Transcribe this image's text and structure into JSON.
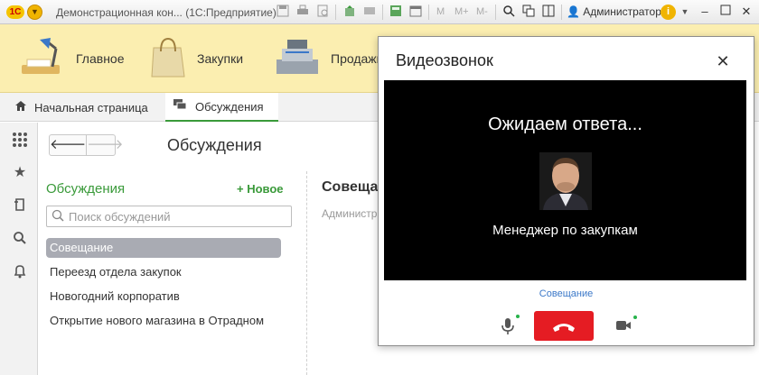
{
  "titlebar": {
    "app_title": "Демонстрационная кон... (1С:Предприятие)",
    "m_label": "M",
    "mplus_label": "M+",
    "mminus_label": "M-",
    "user": "Администратор"
  },
  "sections": [
    {
      "label": "Главное",
      "icon": "desk-lamp-icon"
    },
    {
      "label": "Закупки",
      "icon": "shopping-bag-icon"
    },
    {
      "label": "Продажи",
      "icon": "cash-register-icon"
    }
  ],
  "tabs": [
    {
      "label": "Начальная страница",
      "icon": "home-icon"
    },
    {
      "label": "Обсуждения",
      "icon": "chat-icon"
    }
  ],
  "form": {
    "title": "Обсуждения",
    "list_title": "Обсуждения",
    "new_button": "Новое",
    "search_placeholder": "Поиск обсуждений",
    "discussions": [
      "Совещание",
      "Переезд отдела закупок",
      "Новогодний корпоратив",
      "Открытие нового магазина в Отрадном"
    ],
    "selected_index": 0,
    "right_title": "Совещание",
    "right_subtitle": "Администратор"
  },
  "dialog": {
    "title": "Видеозвонок",
    "waiting_text": "Ожидаем ответа...",
    "callee": "Менеджер по закупкам",
    "conference_link": "Совещание"
  },
  "colors": {
    "accent_green": "#3a9a3a",
    "sections_bg": "#fbeeb0",
    "hangup_red": "#e51c23",
    "link_blue": "#3b78c8",
    "status_dot": "#27b34b"
  }
}
